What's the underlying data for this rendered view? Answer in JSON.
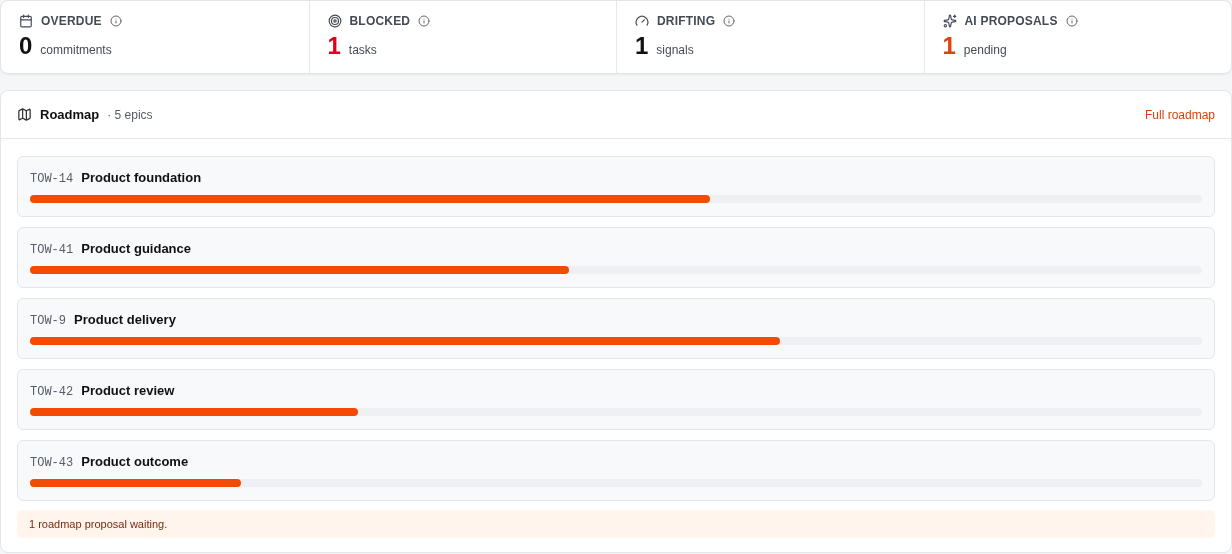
{
  "stats": [
    {
      "label": "OVERDUE",
      "value": "0",
      "unit": "commitments",
      "color": "#111111"
    },
    {
      "label": "BLOCKED",
      "value": "1",
      "unit": "tasks",
      "color": "#e0001b"
    },
    {
      "label": "DRIFTING",
      "value": "1",
      "unit": "signals",
      "color": "#111111"
    },
    {
      "label": "AI PROPOSALS",
      "value": "1",
      "unit": "pending",
      "color": "#e0420c"
    }
  ],
  "roadmap": {
    "title": "Roadmap",
    "count": "· 5 epics",
    "link": "Full roadmap",
    "epics": [
      {
        "key": "TOW-14",
        "name": "Product foundation",
        "level": 0.58
      },
      {
        "key": "TOW-41",
        "name": "Product guidance",
        "level": 0.46
      },
      {
        "key": "TOW-9",
        "name": "Product delivery",
        "level": 0.64
      },
      {
        "key": "TOW-42",
        "name": "Product review",
        "level": 0.28
      },
      {
        "key": "TOW-43",
        "name": "Product outcome",
        "level": 0.18
      }
    ],
    "notice": "1 roadmap proposal waiting."
  }
}
